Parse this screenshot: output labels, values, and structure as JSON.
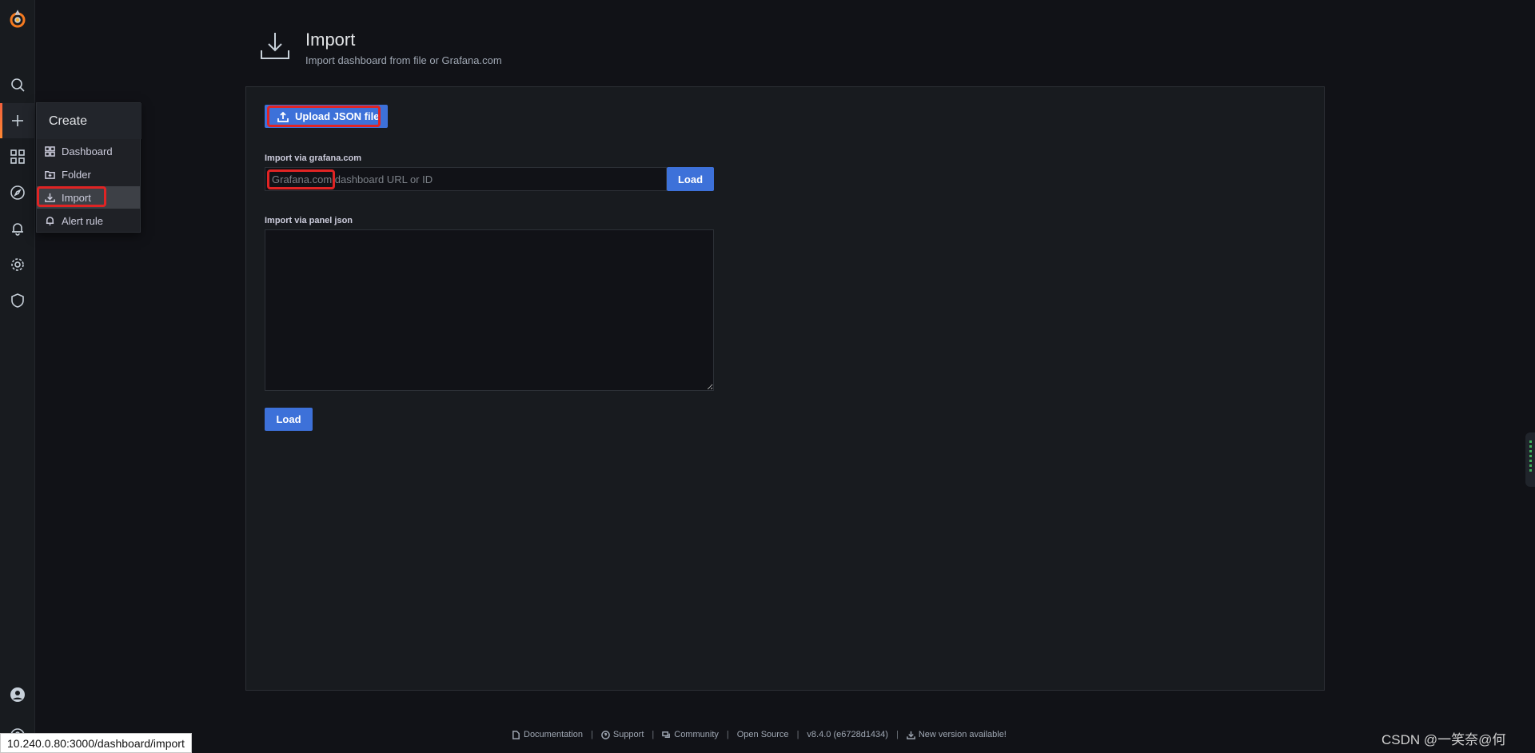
{
  "nav": {
    "create_menu": {
      "title": "Create",
      "items": [
        {
          "label": "Dashboard",
          "icon": "apps-icon"
        },
        {
          "label": "Folder",
          "icon": "folder-plus-icon"
        },
        {
          "label": "Import",
          "icon": "import-icon",
          "selected": true
        },
        {
          "label": "Alert rule",
          "icon": "bell-icon"
        }
      ]
    }
  },
  "header": {
    "title": "Import",
    "subtitle": "Import dashboard from file or Grafana.com"
  },
  "import": {
    "upload_label": "Upload JSON file",
    "grafana_label": "Import via grafana.com",
    "grafana_placeholder": "Grafana.com dashboard URL or ID",
    "grafana_load": "Load",
    "panel_json_label": "Import via panel json",
    "panel_json_load": "Load"
  },
  "footer": {
    "documentation": "Documentation",
    "support": "Support",
    "community": "Community",
    "open_source": "Open Source",
    "version": "v8.4.0 (e6728d1434)",
    "new_version": "New version available!"
  },
  "status_url": "10.240.0.80:3000/dashboard/import",
  "watermark": "CSDN @\u0001一笑奈@何",
  "colors": {
    "accent": "#3d71d9",
    "highlight": "#e02424",
    "brand": "#f2603c"
  }
}
